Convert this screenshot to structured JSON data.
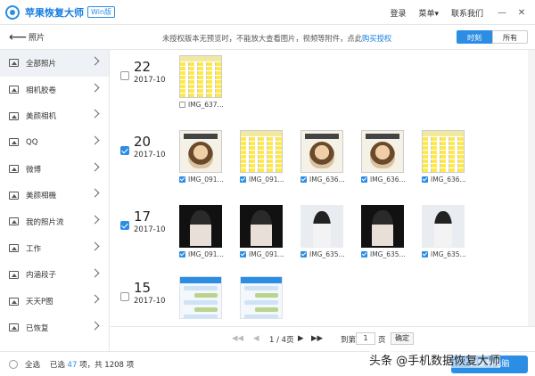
{
  "app": {
    "title": "苹果恢复大师",
    "edition": "Win版",
    "menu": [
      "登录",
      "菜单▾",
      "联系我们"
    ],
    "window_buttons": [
      "—",
      "✕"
    ]
  },
  "toolbar": {
    "back": "⟵",
    "crumb": "照片",
    "notice_prefix": "未授权版本无预览时，不能放大查看图片，视频等附件，点此",
    "notice_link": "购买授权",
    "view_modes": [
      "时刻",
      "所有"
    ]
  },
  "sidebar": {
    "items": [
      {
        "label": "全部照片",
        "active": true
      },
      {
        "label": "相机胶卷"
      },
      {
        "label": "美颜相机"
      },
      {
        "label": "QQ"
      },
      {
        "label": "微博"
      },
      {
        "label": "美颜相機"
      },
      {
        "label": "我的照片流"
      },
      {
        "label": "工作"
      },
      {
        "label": "内涵段子"
      },
      {
        "label": "天天P图"
      },
      {
        "label": "已恢复"
      }
    ]
  },
  "groups": [
    {
      "day": "22",
      "ym": "2017-10",
      "checked": false,
      "photos": [
        {
          "name": "IMG_637...",
          "type": "sheet",
          "checked": false
        }
      ]
    },
    {
      "day": "20",
      "ym": "2017-10",
      "checked": true,
      "photos": [
        {
          "name": "IMG_091...",
          "type": "book",
          "checked": true
        },
        {
          "name": "IMG_091...",
          "type": "sheet",
          "checked": true
        },
        {
          "name": "IMG_636...",
          "type": "book",
          "checked": true
        },
        {
          "name": "IMG_636...",
          "type": "book",
          "checked": true
        },
        {
          "name": "IMG_636...",
          "type": "sheet",
          "checked": true
        }
      ]
    },
    {
      "day": "17",
      "ym": "2017-10",
      "checked": true,
      "photos": [
        {
          "name": "IMG_091...",
          "type": "dark",
          "checked": true
        },
        {
          "name": "IMG_091...",
          "type": "dark",
          "checked": true
        },
        {
          "name": "IMG_635...",
          "type": "light",
          "checked": true
        },
        {
          "name": "IMG_635...",
          "type": "dark",
          "checked": true
        },
        {
          "name": "IMG_635...",
          "type": "light",
          "checked": true
        }
      ]
    },
    {
      "day": "15",
      "ym": "2017-10",
      "checked": false,
      "photos": [
        {
          "name": "",
          "type": "chat",
          "checked": false
        },
        {
          "name": "",
          "type": "chat",
          "checked": false
        }
      ]
    }
  ],
  "pager": {
    "first": "◀◀",
    "prev": "◀",
    "current": "1 / 4页",
    "next": "▶",
    "last": "▶▶",
    "goto_label": "到第",
    "page_value": "1",
    "page_unit": "页",
    "confirm": "确定"
  },
  "footer": {
    "select_all": "全选",
    "selected_prefix": "已选",
    "selected_count": "47",
    "selected_mid": "项，共",
    "total_count": "1208",
    "total_suffix": "项",
    "recover_button": "恢复到电脑"
  },
  "watermark": "头条 @手机数据恢复大师",
  "colors": {
    "accent": "#2c8de4",
    "highlight": "#ffe94a"
  }
}
